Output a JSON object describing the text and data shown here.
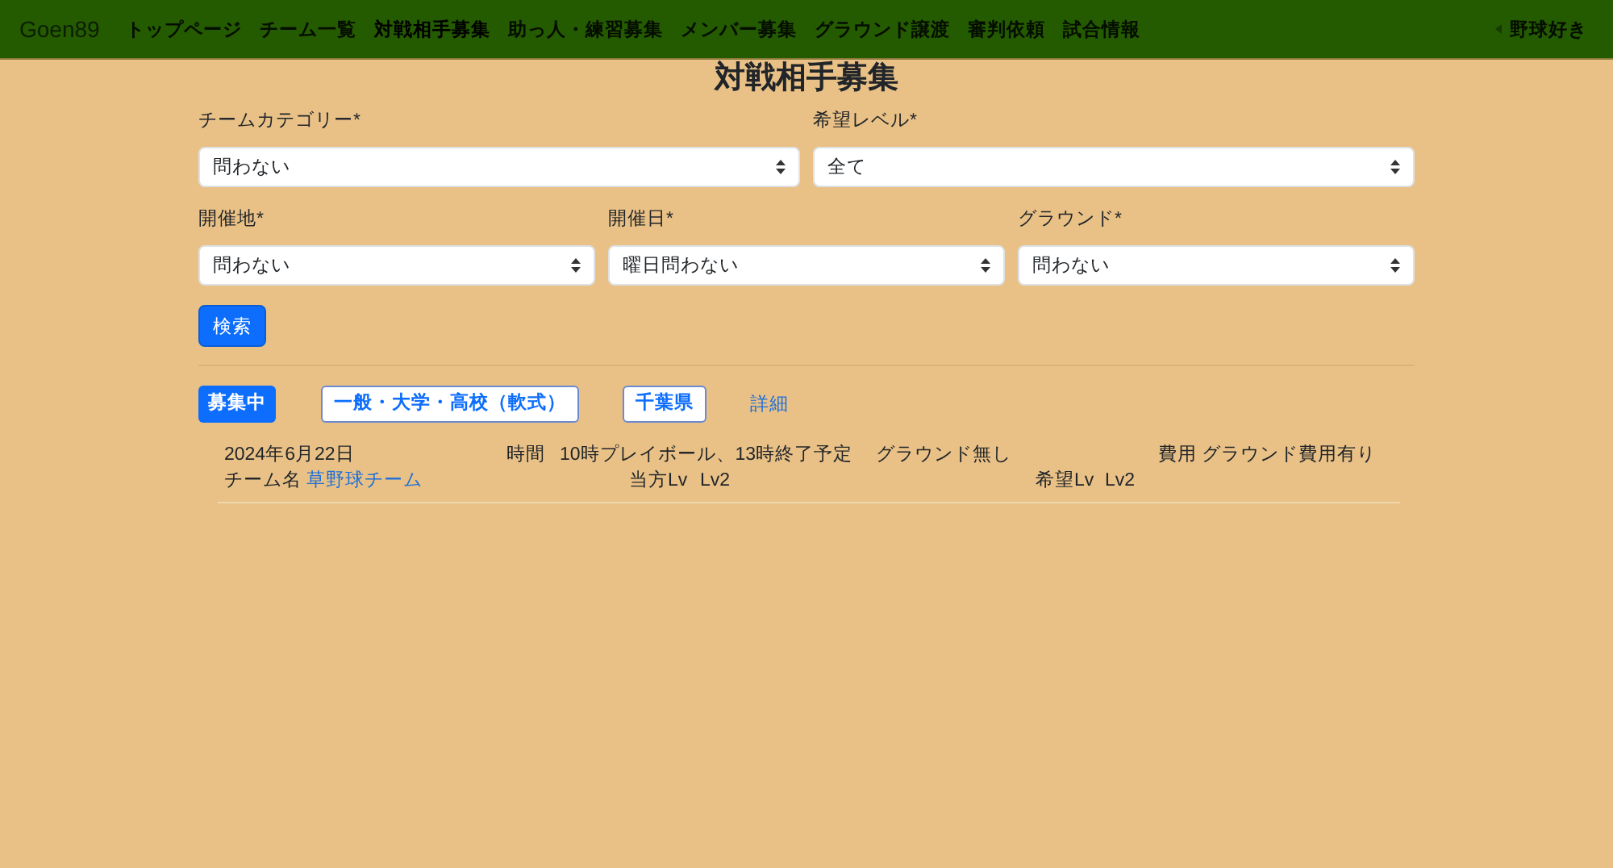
{
  "nav": {
    "brand": "Goen89",
    "items": [
      {
        "label": "トップページ",
        "selected": false
      },
      {
        "label": "チーム一覧",
        "selected": false
      },
      {
        "label": "対戦相手募集",
        "selected": true
      },
      {
        "label": "助っ人・練習募集",
        "selected": false
      },
      {
        "label": "メンバー募集",
        "selected": false
      },
      {
        "label": "グラウンド譲渡",
        "selected": false
      },
      {
        "label": "審判依頼",
        "selected": false
      },
      {
        "label": "試合情報",
        "selected": false
      }
    ],
    "user": "野球好き"
  },
  "title": "対戦相手募集",
  "filter_rows": [
    [
      {
        "label": "チームカテゴリー*",
        "value": "問わない"
      },
      {
        "label": "希望レベル*",
        "value": "全て"
      }
    ],
    [
      {
        "label": "開催地*",
        "value": "問わない"
      },
      {
        "label": "開催日*",
        "value": "曜日問わない"
      },
      {
        "label": "グラウンド*",
        "value": "問わない"
      }
    ]
  ],
  "search_button": "検索",
  "results": [
    {
      "status": "募集中",
      "category": "一般・大学・高校（軟式）",
      "prefecture": "千葉県",
      "detail_link": "詳細",
      "date": "2024年6月22日",
      "time_label": "時間",
      "time": "10時プレイボール、13時終了予定",
      "ground": "グラウンド無し",
      "cost": "費用 グラウンド費用有り",
      "team_label": "チーム名",
      "team": "草野球チーム",
      "own_level_label": "当方Lv",
      "own_level": "Lv2",
      "wanted_level_label": "希望Lv",
      "wanted_level": "Lv2"
    }
  ]
}
